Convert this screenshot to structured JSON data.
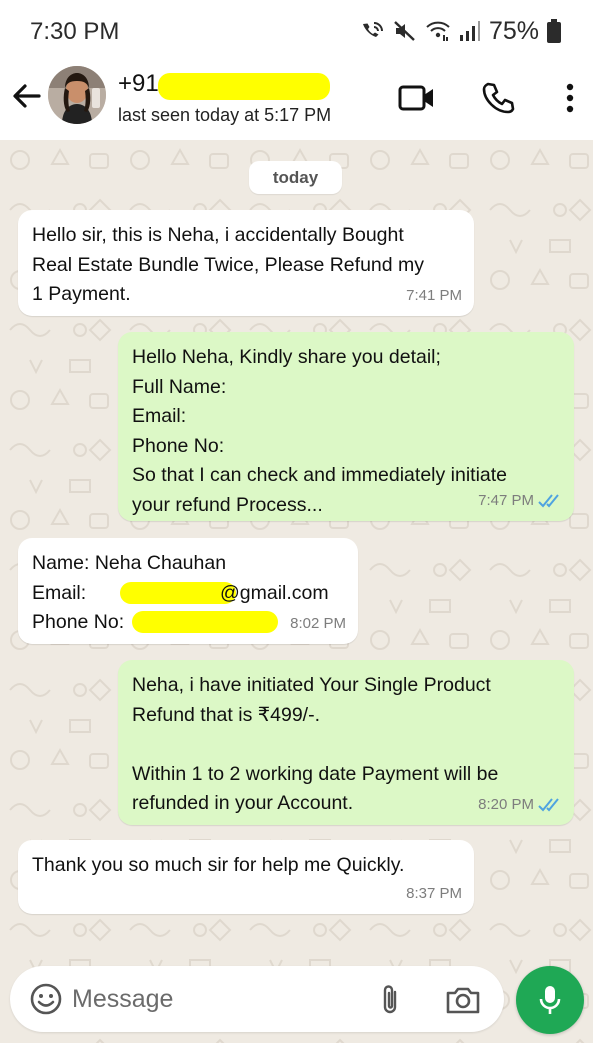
{
  "status_bar": {
    "time": "7:30 PM",
    "battery": "75%",
    "icons": [
      "wifi-call-icon",
      "mute-icon",
      "wifi-icon",
      "signal-icon",
      "battery-icon"
    ]
  },
  "header": {
    "contact_name": "+91",
    "last_seen": "last seen today at 5:17 PM",
    "icons": [
      "back-arrow-icon",
      "video-call-icon",
      "phone-call-icon",
      "more-options-icon"
    ]
  },
  "chat": {
    "date_label": "today",
    "messages": [
      {
        "direction": "incoming",
        "lines": [
          "Hello sir, this is Neha, i accidentally Bought",
          "Real Estate Bundle Twice, Please Refund my",
          "1 Payment."
        ],
        "time": "7:41 PM"
      },
      {
        "direction": "outgoing",
        "lines": [
          "Hello Neha, Kindly share you detail;",
          "Full Name:",
          "Email:",
          "Phone No:",
          "So that I can check and immediately initiate",
          "your refund Process..."
        ],
        "time": "7:47 PM",
        "status": "read"
      },
      {
        "direction": "incoming",
        "lines": [
          "Name: Neha Chauhan",
          "Email:",
          "@gmail.com",
          "Phone No:"
        ],
        "time": "8:02 PM"
      },
      {
        "direction": "outgoing",
        "lines": [
          "Neha, i have initiated Your Single Product",
          "Refund that is ₹499/-.",
          "",
          "Within 1 to 2 working date Payment will be",
          "refunded in your Account."
        ],
        "time": "8:20 PM",
        "status": "read"
      },
      {
        "direction": "incoming",
        "lines": [
          "Thank you so much sir for help me Quickly."
        ],
        "time": "8:37 PM"
      }
    ]
  },
  "input_bar": {
    "placeholder": "Message",
    "icons": [
      "emoji-icon",
      "attach-icon",
      "camera-icon",
      "mic-icon"
    ]
  },
  "colors": {
    "incoming_bubble": "#ffffff",
    "outgoing_bubble": "#dcf8c6",
    "chat_background": "#efeae2",
    "mic_button": "#1fa855",
    "read_ticks": "#4fa3e0",
    "redaction": "#ffff00"
  }
}
